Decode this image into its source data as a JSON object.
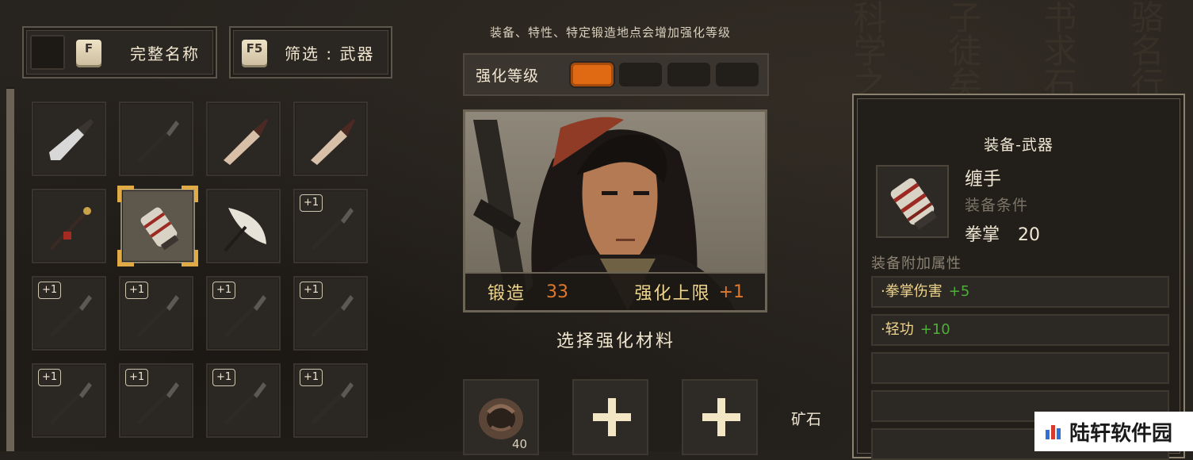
{
  "toolbar": {
    "fullname_key": "F",
    "fullname_label": "完整名称",
    "filter_key": "F5",
    "filter_label": "筛选 : 武器"
  },
  "inventory": {
    "slots": [
      {
        "badge": "",
        "item": "cleaver"
      },
      {
        "badge": "",
        "item": "spear-tip"
      },
      {
        "badge": "",
        "item": "dagger"
      },
      {
        "badge": "",
        "item": "dagger"
      },
      {
        "badge": "",
        "item": "spear-red"
      },
      {
        "badge": "",
        "item": "hand-wraps",
        "selected": true
      },
      {
        "badge": "",
        "item": "fan-blade"
      },
      {
        "badge": "+1",
        "item": "spear-tip"
      },
      {
        "badge": "+1",
        "item": "spear-tip"
      },
      {
        "badge": "+1",
        "item": "spear-tip"
      },
      {
        "badge": "+1",
        "item": "spear-tip"
      },
      {
        "badge": "+1",
        "item": "spear-tip"
      },
      {
        "badge": "+1",
        "item": "spear-tip"
      },
      {
        "badge": "+1",
        "item": "spear-tip"
      },
      {
        "badge": "+1",
        "item": "spear-tip"
      },
      {
        "badge": "+1",
        "item": "spear-tip"
      }
    ]
  },
  "enhance": {
    "hint": "装备、特性、特定锻造地点会增加强化等级",
    "level_label": "强化等级",
    "level_current": 1,
    "level_max": 4,
    "forge_label": "锻造",
    "forge_value": "33",
    "cap_label": "强化上限",
    "cap_value": "+1",
    "select_title": "选择强化材料",
    "materials": [
      {
        "type": "ore",
        "count": "40"
      },
      {
        "type": "empty"
      },
      {
        "type": "empty"
      }
    ],
    "material_type_label": "矿石"
  },
  "details": {
    "category": "装备-武器",
    "name": "缠手",
    "requirement_label": "装备条件",
    "requirement_stat": "拳掌",
    "requirement_value": "20",
    "attr_title": "装备附加属性",
    "attributes": [
      {
        "name": "·拳掌伤害",
        "value": "+5"
      },
      {
        "name": "·轻功",
        "value": "+10"
      },
      {
        "name": "",
        "value": ""
      },
      {
        "name": "",
        "value": ""
      },
      {
        "name": "",
        "value": ""
      }
    ]
  },
  "watermark": {
    "text": "陆轩软件园"
  },
  "colors": {
    "accent_orange": "#e06a14",
    "highlight_gold": "#e0aa45",
    "stat_green": "#4fae3a"
  }
}
